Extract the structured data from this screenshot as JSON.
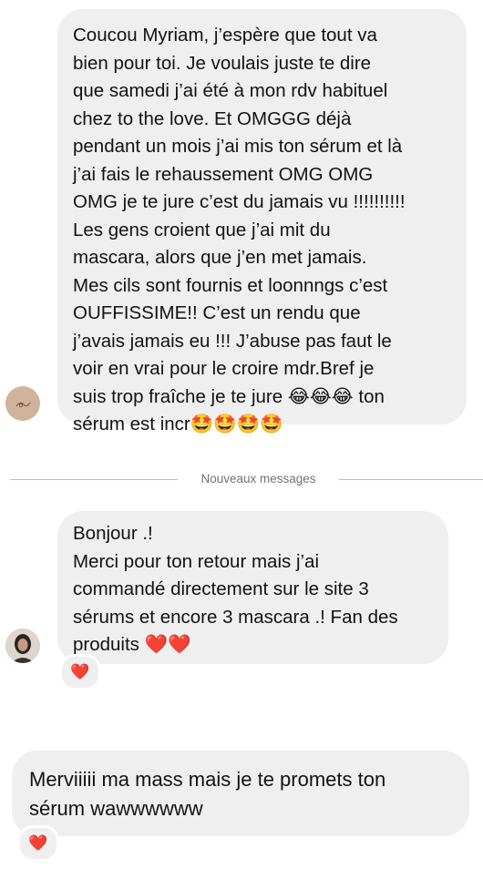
{
  "conversation": {
    "messages": [
      {
        "sender": "contact",
        "text": "Coucou Myriam, j’espère que tout va\nbien pour toi. Je voulais juste te dire\nque samedi j’ai été à mon rdv habituel\nchez to the love. Et OMGGG déjà\npendant un mois j’ai mis ton sérum et là\nj’ai fais  le rehaussement OMG OMG\nOMG je te jure c’est du jamais vu !!!!!!!!!!\nLes gens croient que j’ai mit du\nmascara, alors que j’en met jamais.\nMes cils sont fournis et loonnngs c’est\nOUFFISSIME!! C’est un rendu que\nj’avais jamais eu !!! J’abuse pas faut le\nvoir en vrai pour le croire mdr.Bref je\nsuis trop fraîche je te jure 😂😂😂 ton\nsérum est incr🤩🤩🤩🤩"
      },
      {
        "sender": "account",
        "text": "Bonjour .!\nMerci pour ton retour mais j’ai\ncommandé directement sur le site 3\nsérums et encore 3 mascara .! Fan des\nproduits ❤️❤️",
        "reaction": "❤️"
      },
      {
        "sender": "contact",
        "text": "Merviiiii ma mass mais je te promets ton\nsérum wawwwwww",
        "reaction": "❤️"
      }
    ],
    "divider_label": "Nouveaux messages"
  },
  "icons": {
    "contact_avatar": "contact-logo-avatar",
    "account_avatar": "account-photo-avatar",
    "reaction": "red-heart-icon"
  },
  "colors": {
    "bubble": "#efefef",
    "divider": "#bdbdbd",
    "divider_text": "#737373",
    "heart": "#e0161e"
  }
}
